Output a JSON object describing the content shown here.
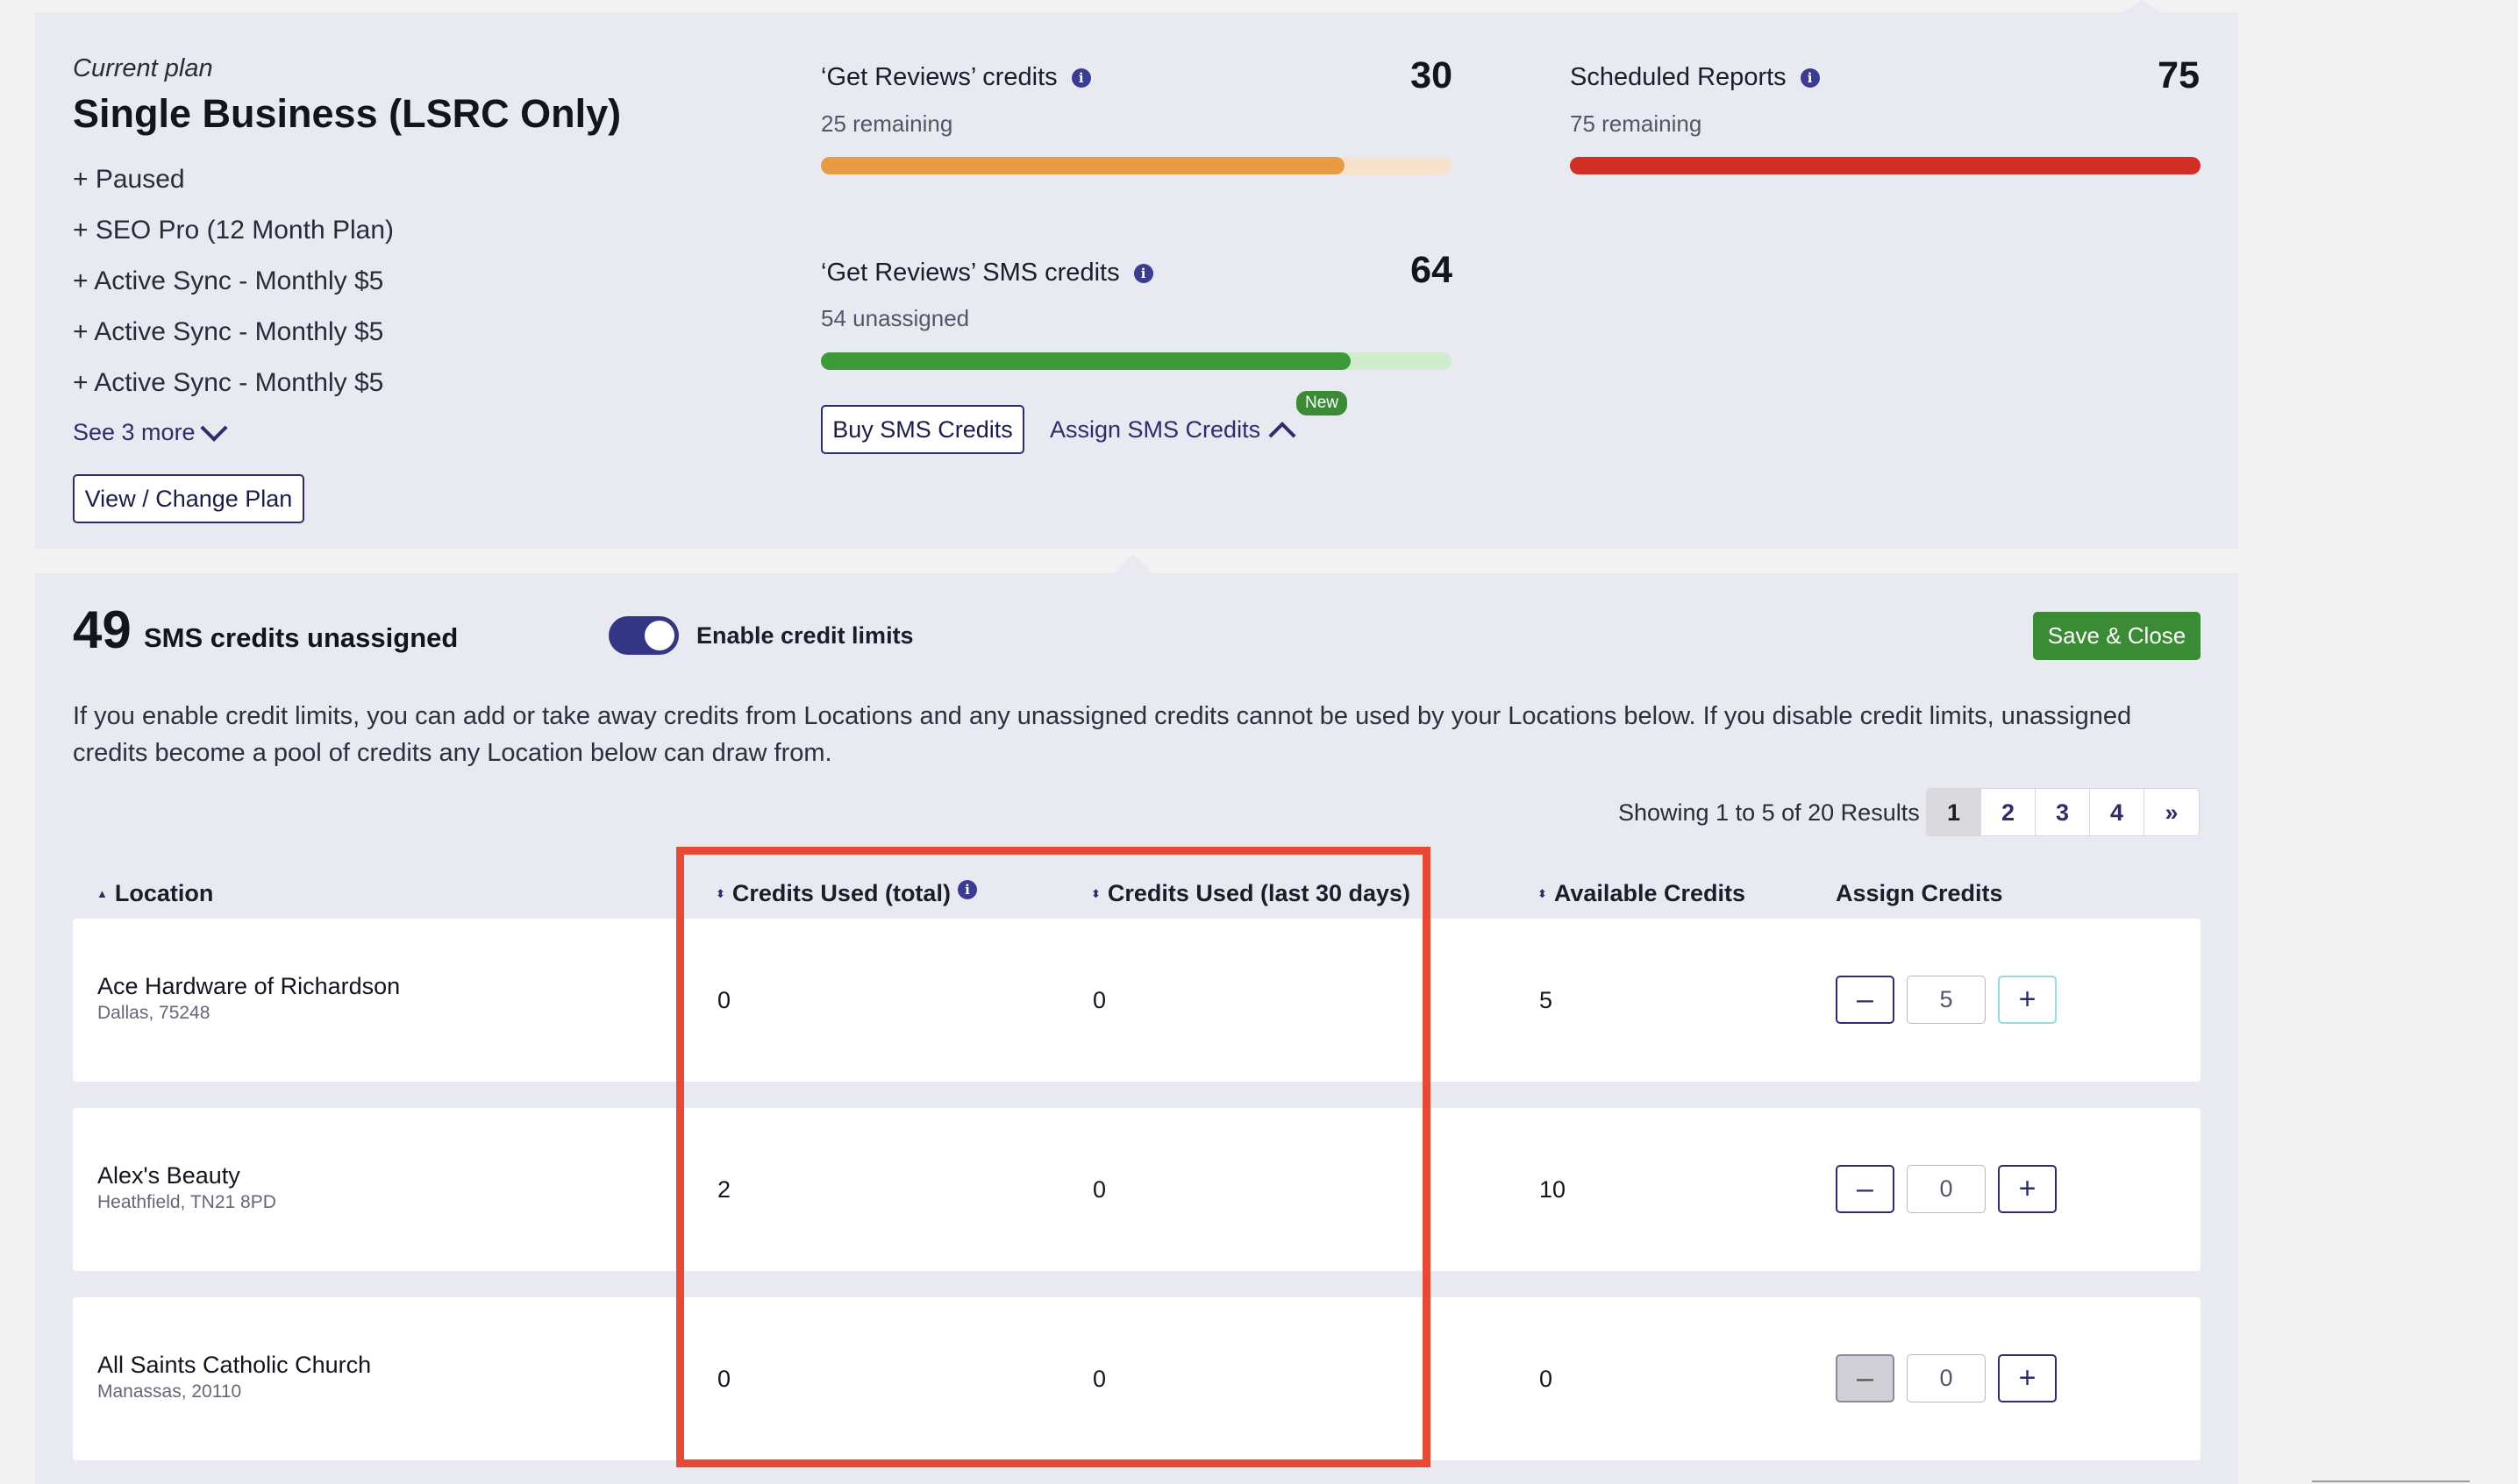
{
  "plan": {
    "current_label": "Current plan",
    "name": "Single Business (LSRC Only)",
    "addons": [
      "+ Paused",
      "+ SEO Pro (12 Month Plan)",
      "+ Active Sync - Monthly $5",
      "+ Active Sync - Monthly $5",
      "+ Active Sync - Monthly $5"
    ],
    "see_more": "See 3 more",
    "change_button": "View / Change Plan"
  },
  "credits": {
    "reviews": {
      "title": "‘Get Reviews’ credits",
      "total": "30",
      "sub": "25 remaining",
      "fill_fraction": 0.83,
      "color": "#e79b45",
      "track_color": "#f7e3cd"
    },
    "sms": {
      "title": "‘Get Reviews’ SMS credits",
      "total": "64",
      "sub": "54 unassigned",
      "fill_fraction": 0.84,
      "color": "#3d9a3a",
      "track_color": "#cfeccd"
    },
    "reports": {
      "title": "Scheduled Reports",
      "total": "75",
      "sub": "75 remaining",
      "fill_fraction": 1.0,
      "color": "#d12e26",
      "track_color": "#f3c7c4"
    },
    "buy_button": "Buy SMS Credits",
    "assign_link": "Assign SMS Credits",
    "new_badge": "New"
  },
  "assign": {
    "unassigned_count": "49",
    "unassigned_label": "SMS credits unassigned",
    "toggle_label": "Enable credit limits",
    "toggle_on": true,
    "save_button": "Save & Close",
    "description": "If you enable credit limits, you can add or take away credits from Locations and any unassigned credits cannot be used by your Locations below. If you disable credit limits, unassigned credits become a pool of credits any Location below can draw from.",
    "showing": "Showing 1 to 5 of 20 Results",
    "pages": [
      "1",
      "2",
      "3",
      "4",
      "»"
    ],
    "active_page": "1"
  },
  "table": {
    "headers": {
      "location": "Location",
      "used_total": "Credits Used (total)",
      "used_30": "Credits Used (last 30 days)",
      "available": "Available Credits",
      "assign": "Assign Credits"
    },
    "rows": [
      {
        "name": "Ace Hardware of Richardson",
        "sub": "Dallas, 75248",
        "used_total": "0",
        "used_30": "0",
        "available": "5",
        "assign": "5"
      },
      {
        "name": "Alex's Beauty",
        "sub": "Heathfield, TN21 8PD",
        "used_total": "2",
        "used_30": "0",
        "available": "10",
        "assign": "0"
      },
      {
        "name": "All Saints Catholic Church",
        "sub": "Manassas, 20110",
        "used_total": "0",
        "used_30": "0",
        "available": "0",
        "assign": "0"
      }
    ]
  }
}
